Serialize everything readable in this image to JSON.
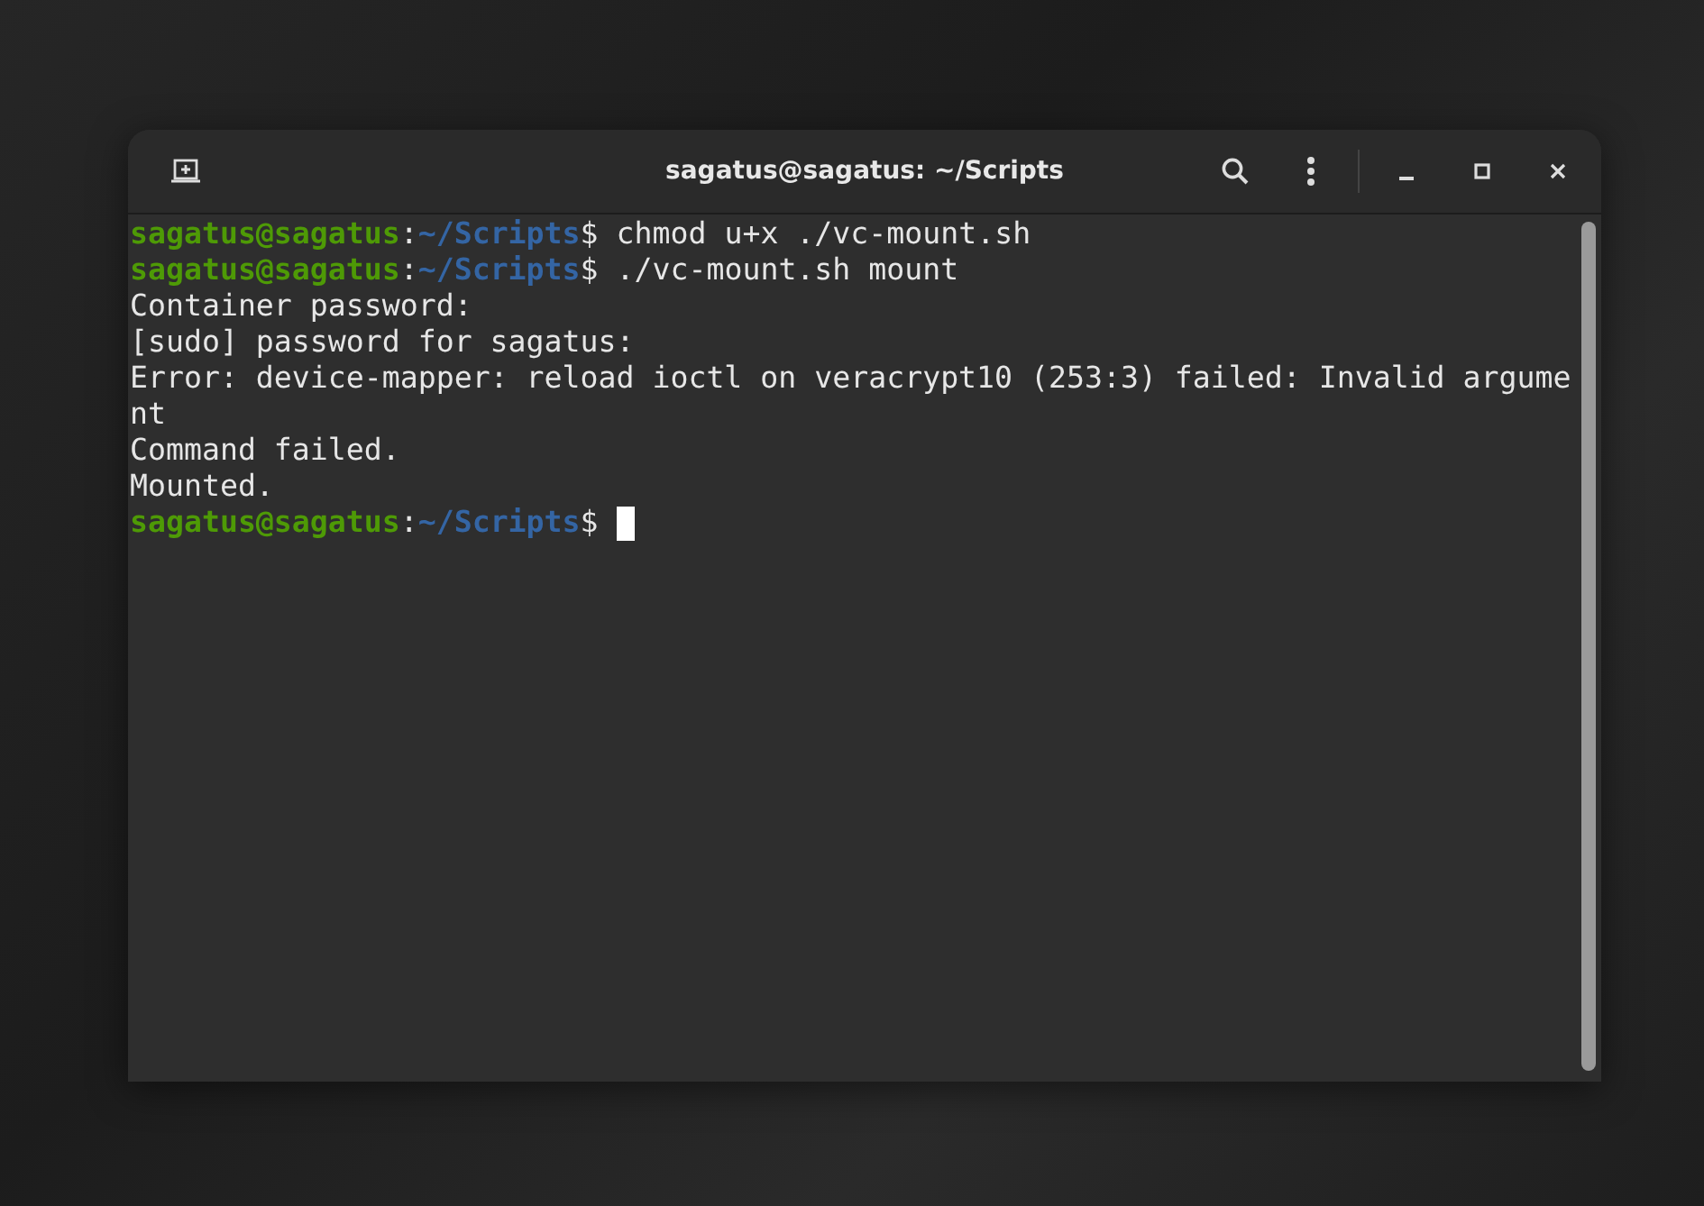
{
  "window": {
    "title": "sagatus@sagatus: ~/Scripts"
  },
  "terminal": {
    "lines": [
      {
        "kind": "prompt",
        "user": "sagatus@sagatus",
        "separator": ":",
        "path": "~/Scripts",
        "symbol": "$",
        "command": "chmod u+x ./vc-mount.sh",
        "cursor": false
      },
      {
        "kind": "prompt",
        "user": "sagatus@sagatus",
        "separator": ":",
        "path": "~/Scripts",
        "symbol": "$",
        "command": "./vc-mount.sh mount",
        "cursor": false
      },
      {
        "kind": "output",
        "text": "Container password:"
      },
      {
        "kind": "output",
        "text": "[sudo] password for sagatus:"
      },
      {
        "kind": "output",
        "text": "Error: device-mapper: reload ioctl on veracrypt10 (253:3) failed: Invalid argume"
      },
      {
        "kind": "output",
        "text": "nt"
      },
      {
        "kind": "output",
        "text": "Command failed."
      },
      {
        "kind": "output",
        "text": "Mounted."
      },
      {
        "kind": "prompt",
        "user": "sagatus@sagatus",
        "separator": ":",
        "path": "~/Scripts",
        "symbol": "$",
        "cursor": true
      }
    ]
  }
}
